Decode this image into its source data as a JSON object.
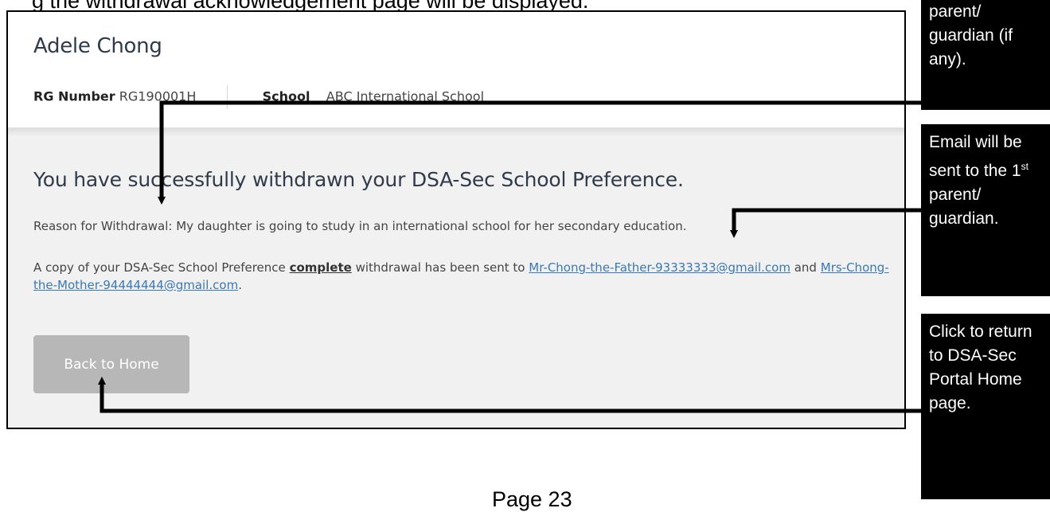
{
  "top_caption": "g the withdrawal acknowledgement page will be displayed.",
  "student": {
    "name": "Adele Chong",
    "rg_label": "RG Number",
    "rg_value": "RG190001H",
    "school_label": "School",
    "school_value": "ABC International School"
  },
  "confirmation": {
    "title": "You have successfully withdrawn your DSA-Sec School Preference.",
    "reason_label": "Reason for Withdrawal:",
    "reason_text": "My daughter is going to study in an international school for her secondary education.",
    "copy_prefix": "A copy of your DSA-Sec School Preference",
    "copy_emphasis": "complete",
    "copy_middle": "withdrawal has been sent to",
    "email_1": "Mr-Chong-the-Father-93333333@gmail.com",
    "copy_and": "and",
    "email_2": "Mrs-Chong-the-Mother-94444444@gmail.com",
    "copy_end": "."
  },
  "back_button_label": "Back to Home",
  "callouts": {
    "c1": "parent/ guardian (if any).",
    "c2_prefix": "Email will be sent to the 1",
    "c2_sup": "st",
    "c2_suffix": "parent/ guardian.",
    "c3": "Click to return to DSA-Sec Portal Home page."
  },
  "page_number": "Page 23"
}
